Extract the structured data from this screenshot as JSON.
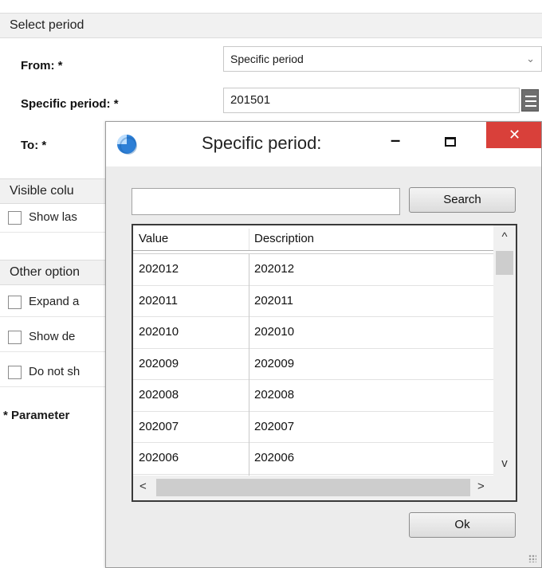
{
  "form": {
    "select_period_header": "Select period",
    "from_label": "From: *",
    "from_value": "Specific period",
    "specific_period_label": "Specific period: *",
    "specific_period_value": "201501",
    "to_label": "To: *",
    "visible_columns_header": "Visible colu",
    "show_last_label": "Show las",
    "other_options_header": "Other option",
    "expand_label": "Expand a",
    "show_details_label": "Show de",
    "do_not_show_label": "Do not sh",
    "footnote": "* Parameter"
  },
  "dialog": {
    "title": "Specific period:",
    "search_value": "",
    "search_button": "Search",
    "ok_button": "Ok",
    "columns": [
      "Value",
      "Description"
    ],
    "rows": [
      {
        "value": "202012",
        "description": "202012"
      },
      {
        "value": "202011",
        "description": "202011"
      },
      {
        "value": "202010",
        "description": "202010"
      },
      {
        "value": "202009",
        "description": "202009"
      },
      {
        "value": "202008",
        "description": "202008"
      },
      {
        "value": "202007",
        "description": "202007"
      },
      {
        "value": "202006",
        "description": "202006"
      }
    ],
    "window_controls": {
      "minimize": "–",
      "maximize": "☐",
      "close": "✕"
    },
    "scroll_arrows": {
      "up": "^",
      "down": "v",
      "left": "<",
      "right": ">"
    }
  },
  "icons": {
    "app_icon": "pie-chart-icon",
    "lookup_icon": "menu-lines-icon",
    "dropdown_icon": "chevron-down-icon"
  },
  "colors": {
    "close_button": "#d9403a",
    "dialog_background": "#ececec",
    "header_background": "#f1f1f1"
  }
}
